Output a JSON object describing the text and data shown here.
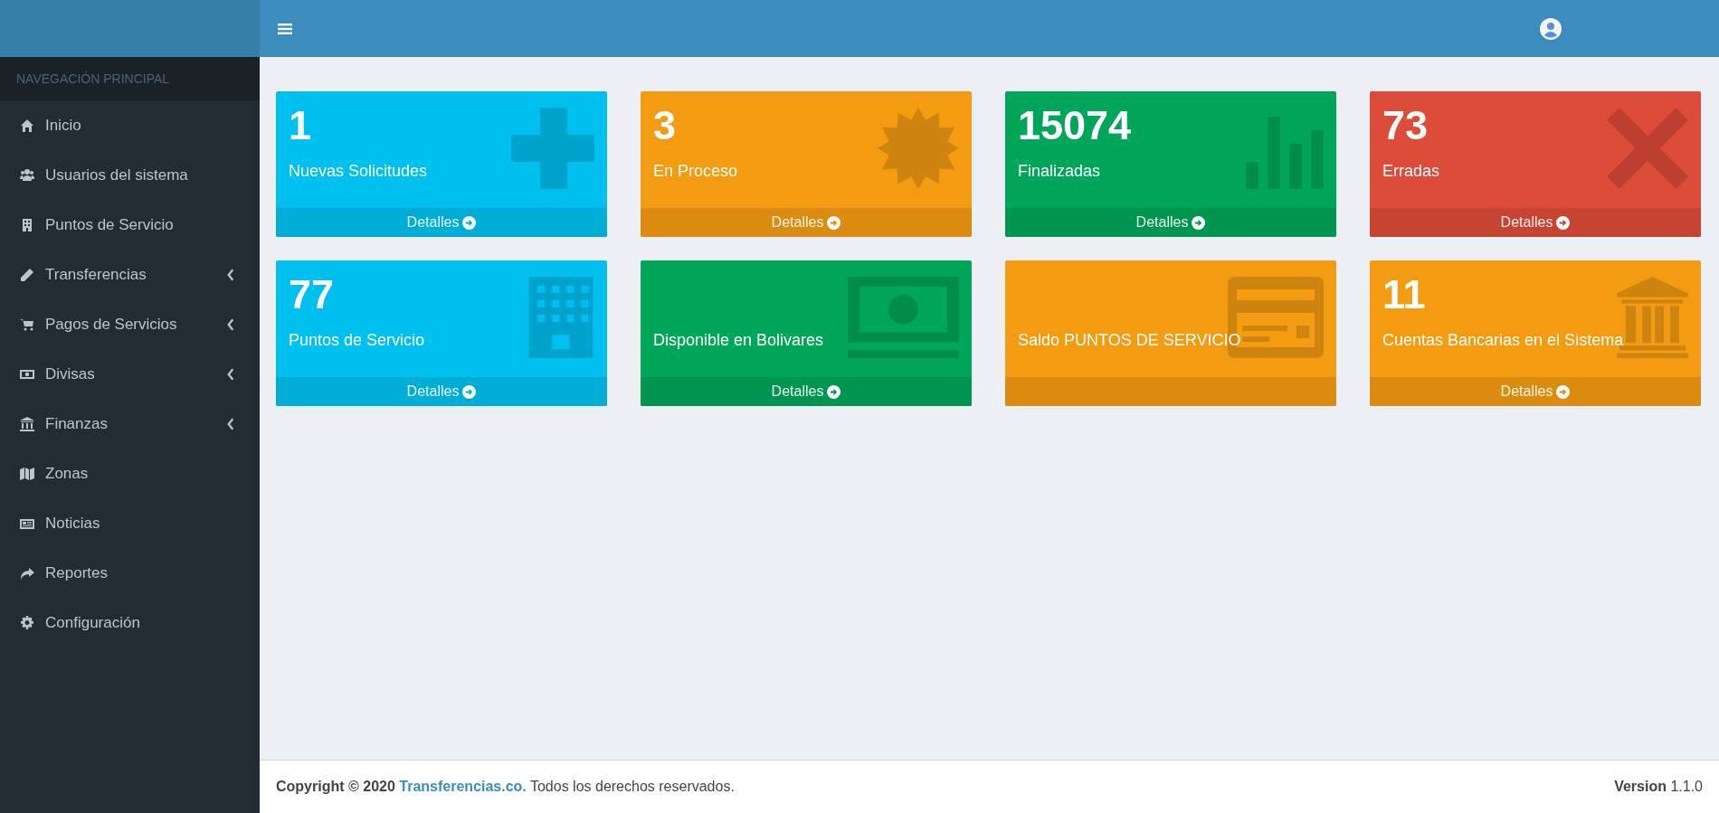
{
  "sidebar": {
    "header": "NAVEGACIÓN PRINCIPAL",
    "items": [
      {
        "label": "Inicio",
        "expandable": false
      },
      {
        "label": "Usuarios del sistema",
        "expandable": false
      },
      {
        "label": "Puntos de Servicio",
        "expandable": false
      },
      {
        "label": "Transferencias",
        "expandable": true
      },
      {
        "label": "Pagos de Servicios",
        "expandable": true
      },
      {
        "label": "Divisas",
        "expandable": true
      },
      {
        "label": "Finanzas",
        "expandable": true
      },
      {
        "label": "Zonas",
        "expandable": false
      },
      {
        "label": "Noticias",
        "expandable": false
      },
      {
        "label": "Reportes",
        "expandable": false
      },
      {
        "label": "Configuración",
        "expandable": false
      }
    ]
  },
  "boxes": [
    {
      "value": "1",
      "label": "Nuevas Solicitudes",
      "link": "Detalles",
      "color": "#00c0ef"
    },
    {
      "value": "3",
      "label": "En Proceso",
      "link": "Detalles",
      "color": "#f39c12"
    },
    {
      "value": "15074",
      "label": "Finalizadas",
      "link": "Detalles",
      "color": "#00a65a"
    },
    {
      "value": "73",
      "label": "Erradas",
      "link": "Detalles",
      "color": "#dd4b39"
    },
    {
      "value": "77",
      "label": "Puntos de Servicio",
      "link": "Detalles",
      "color": "#00c0ef"
    },
    {
      "label": "Disponible en Bolivares",
      "link": "Detalles",
      "color": "#00a65a"
    },
    {
      "label": "Saldo PUNTOS DE SERVICIO",
      "color": "#f39c12"
    },
    {
      "value": "11",
      "label": "Cuentas Bancarias en el Sistema",
      "link": "Detalles",
      "color": "#f39c12"
    }
  ],
  "footer": {
    "copyright": "**Copyright © 2020** ",
    "link": "Transferencias.co.",
    "rest": " Todos los derechos reservados.",
    "version_label": "Version",
    "version": "1.1.0"
  }
}
